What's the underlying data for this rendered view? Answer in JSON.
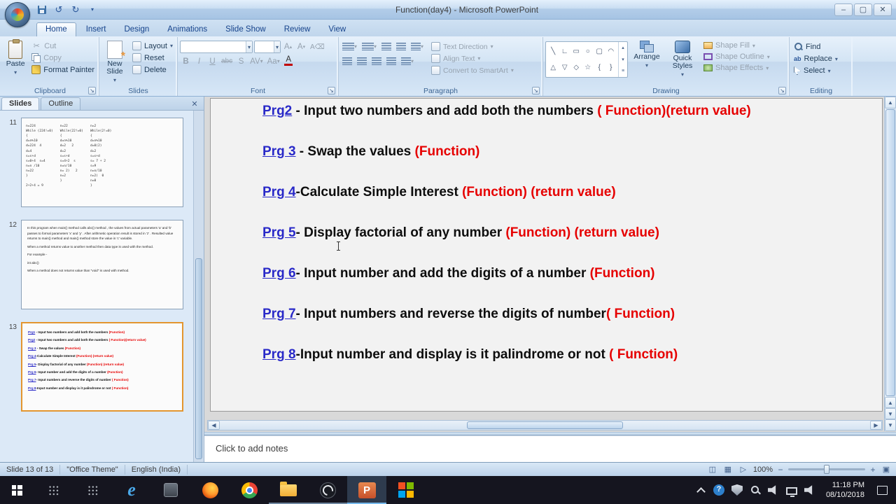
{
  "titlebar": {
    "title": "Function(day4) - Microsoft PowerPoint"
  },
  "ribbon": {
    "active_tab": "Home",
    "tabs": [
      {
        "label": "Home"
      },
      {
        "label": "Insert"
      },
      {
        "label": "Design"
      },
      {
        "label": "Animations"
      },
      {
        "label": "Slide Show"
      },
      {
        "label": "Review"
      },
      {
        "label": "View"
      }
    ],
    "clipboard": {
      "group_label": "Clipboard",
      "paste": "Paste",
      "cut": "Cut",
      "copy": "Copy",
      "format_painter": "Format Painter"
    },
    "slides": {
      "group_label": "Slides",
      "new_slide": "New Slide",
      "layout": "Layout",
      "reset": "Reset",
      "delete": "Delete"
    },
    "font": {
      "group_label": "Font",
      "bold": "B",
      "italic": "I",
      "underline": "U",
      "strikethrough": "abc",
      "shadow": "S",
      "char_spacing": "AV",
      "change_case": "Aa",
      "font_color": "A",
      "grow_font": "A",
      "shrink_font": "A"
    },
    "paragraph": {
      "group_label": "Paragraph",
      "text_direction": "Text Direction",
      "align_text": "Align Text",
      "convert_to_smartart": "Convert to SmartArt"
    },
    "drawing": {
      "group_label": "Drawing",
      "arrange": "Arrange",
      "quick_styles": "Quick Styles",
      "shape_fill": "Shape Fill",
      "shape_outline": "Shape Outline",
      "shape_effects": "Shape Effects",
      "shapes": [
        {
          "name": "line",
          "glyph": "╲"
        },
        {
          "name": "elbow-connector",
          "glyph": "∟"
        },
        {
          "name": "rectangle",
          "glyph": "▭"
        },
        {
          "name": "ellipse",
          "glyph": "○"
        },
        {
          "name": "rounded-rectangle",
          "glyph": "▢"
        },
        {
          "name": "arc",
          "glyph": "◠"
        },
        {
          "name": "triangle",
          "glyph": "△"
        },
        {
          "name": "down-triangle",
          "glyph": "▽"
        },
        {
          "name": "diamond",
          "glyph": "◇"
        },
        {
          "name": "star",
          "glyph": "☆"
        },
        {
          "name": "left-brace",
          "glyph": "{"
        },
        {
          "name": "right-brace",
          "glyph": "}"
        }
      ]
    },
    "editing": {
      "group_label": "Editing",
      "find": "Find",
      "replace": "Replace",
      "select": "Select"
    }
  },
  "slide_panel": {
    "tabs": [
      "Slides",
      "Outline"
    ],
    "active_tab": "Slides",
    "thumbnails": [
      {
        "number": "11",
        "columns": [
          "n=224\nWhile (224!=0)\n{\nd=n%10\nd=224  4\nd=4\ns=s+d\ns=0+4  s=4\nn=n /10\nn=22\n}\n\n2+2+4 = 9",
          "n=22\nWhile(22!=0)\n{\nd=n%10\nd=2   2\nd=2\ns=s+d\ns=4+2  s\nn=n/10\nn= 2)   2\nn=2\n}",
          "n=2\nWhile(2!=0)\n{\nd=n%10\nd=0(2)\nd=2\ns=s+d\ns= 7 + 2\ns=9\nn=n/10\nn=2)  0\nn=0\n}"
        ]
      },
      {
        "number": "12",
        "paragraphs": [
          "In this program when main() method calls abc() method , the values from actual parameters 'a' and 'b' passes to formal parameters 'x' and 'y' . After arithmetic operation result is stored in 'z' . Resulted value returns to main() method and main() method store the value in 'c' variable.",
          "When a method returns value to another method then data type is used with the method.",
          "For example -",
          "int abc()",
          "When a method does not returns value than \"void\" is used with method."
        ]
      },
      {
        "number": "13",
        "selected": true
      }
    ],
    "thumb13_lines": [
      {
        "prg": "Prg1",
        "body": " - Input two numbers and add both the numbers ",
        "red": "(Function)"
      },
      {
        "prg": "Prg2",
        "body": " - Input two numbers and add both the numbers ",
        "red": "( Function)(return  value)"
      },
      {
        "prg": "Prg 3",
        "body": " - Swap the values ",
        "red": "(Function)"
      },
      {
        "prg": "Prg 4",
        "body": "-Calculate Simple  Interest ",
        "red": "(Function) (return value)"
      },
      {
        "prg": "Prg 5",
        "body": "- Display factorial of any number ",
        "red": "(Function) (return value)"
      },
      {
        "prg": "Prg 6",
        "body": "- Input number and add the digits of a number ",
        "red": "(Function)"
      },
      {
        "prg": "Prg 7",
        "body": "- Input numbers and reverse the digits of number ",
        "red": "( Function)"
      },
      {
        "prg": "Prg 8",
        "body": "-Input number and display  is it palindrome  or not ",
        "red": "( Function)"
      }
    ]
  },
  "slide": {
    "lines": [
      {
        "prg": "Prg2",
        "body": " - Input two numbers and add both the numbers ",
        "red": "( Function)(return  value)"
      },
      {
        "prg": "Prg 3",
        "body": " - Swap the values ",
        "red": "(Function)"
      },
      {
        "prg": "Prg 4",
        "body": "-Calculate Simple Interest ",
        "red": "(Function) (return value)"
      },
      {
        "prg": "Prg 5",
        "body": "- Display factorial of any number ",
        "red": "(Function) (return value)"
      },
      {
        "prg": "Prg 6",
        "body": "- Input number and add the digits of a number ",
        "red": "(Function)"
      },
      {
        "prg": "Prg 7",
        "body": "- Input numbers and reverse the digits of number",
        "red": "( Function)"
      },
      {
        "prg": "Prg 8",
        "body": "-Input number and display is it palindrome or not ",
        "red": "( Function)"
      }
    ]
  },
  "notes": {
    "placeholder": "Click to add notes"
  },
  "status_bar": {
    "slide_info": "Slide 13 of 13",
    "theme": "\"Office Theme\"",
    "language": "English (India)",
    "zoom_level": "100%"
  },
  "taskbar": {
    "apps": [
      {
        "name": "search"
      },
      {
        "name": "task-view"
      },
      {
        "name": "internet-explorer"
      },
      {
        "name": "app-window"
      },
      {
        "name": "firefox"
      },
      {
        "name": "chrome"
      },
      {
        "name": "file-explorer",
        "state": "open"
      },
      {
        "name": "obs-studio",
        "state": "open"
      },
      {
        "name": "powerpoint",
        "state": "active"
      },
      {
        "name": "colored-grid"
      }
    ],
    "tray_icons": [
      "hidden-icons-chevron",
      "help",
      "shield",
      "magnifier",
      "volume",
      "network",
      "speaker"
    ],
    "time": "11:18 PM",
    "date": "08/10/2018"
  },
  "colors": {
    "prg_blue": "#2929c8",
    "function_red": "#e60000",
    "selection_orange": "#e3962f",
    "ribbon_blue": "#d7e7f7",
    "taskbar_dark": "#15151f"
  }
}
